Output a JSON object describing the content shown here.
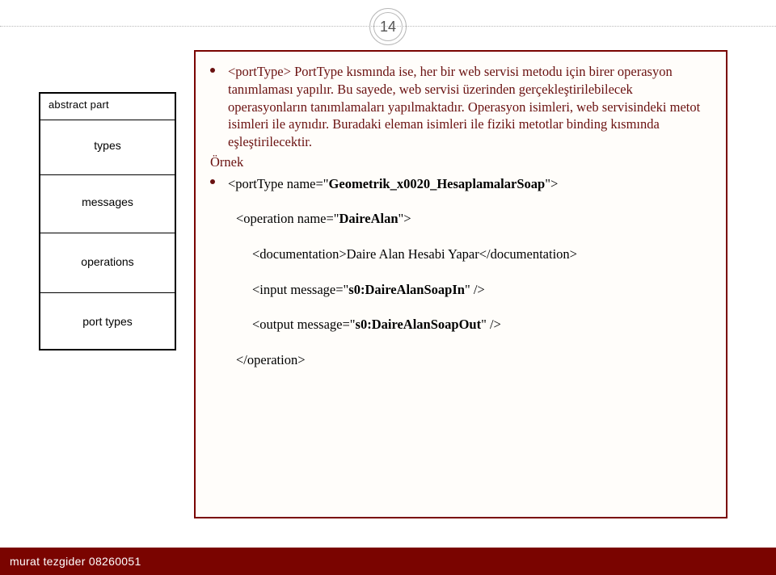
{
  "page_number": "14",
  "diagram": {
    "abstract_label": "abstract part",
    "cells": [
      "types",
      "messages",
      "operations",
      "port types"
    ]
  },
  "content": {
    "para1_tag": "<portType>",
    "para1_rest": " PortType kısmında ise, her bir web servisi metodu için birer operasyon tanımlaması yapılır. Bu sayede, web servisi üzerinden gerçekleştirilebilecek operasyonların tanımlamaları yapılmaktadır. Operasyon isimleri, web servisindeki metot isimleri ile aynıdır. Buradaki eleman isimleri ile fiziki metotlar binding kısmında eşleştirilecektir.",
    "ornek": "Örnek",
    "code": {
      "porttype_open": "<portType name=\"",
      "porttype_name": "Geometrik_x0020_HesaplamalarSoap",
      "porttype_close_attr": "\">",
      "operation_open": "<operation name=\"",
      "operation_name": "DaireAlan",
      "operation_close_attr": "\">",
      "doc_line": "<documentation>Daire Alan Hesabi Yapar</documentation>",
      "input_open": "<input message=\"",
      "input_msg": "s0:DaireAlanSoapIn",
      "input_close": "\" />",
      "output_open": "<output message=\"",
      "output_msg": "s0:DaireAlanSoapOut",
      "output_close": "\" />",
      "operation_end": "</operation>"
    }
  },
  "footer": "murat tezgider 08260051"
}
